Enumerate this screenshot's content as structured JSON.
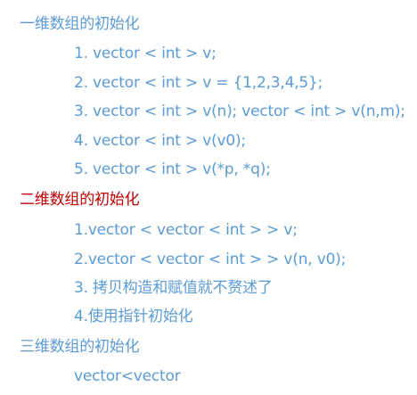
{
  "colors": {
    "heading_blue": "#5b9bd5",
    "heading_red": "#c00000",
    "item_blue": "#5b9bd5"
  },
  "sections": [
    {
      "heading": "一维数组的初始化",
      "items": [
        "1. vector < int > v;",
        "2. vector < int > v = {1,2,3,4,5};",
        "3. vector < int > v(n); vector < int > v(n,m);",
        "4. vector < int > v(v0);",
        "5. vector < int > v(*p, *q);"
      ]
    },
    {
      "heading": "二维数组的初始化",
      "items": [
        "1.vector < vector < int > > v;",
        "2.vector < vector < int > > v(n, v0);",
        "3. 拷贝构造和赋值就不赘述了",
        "4.使用指针初始化"
      ]
    },
    {
      "heading": "三维数组的初始化",
      "items": [
        "vector<vector"
      ]
    }
  ]
}
